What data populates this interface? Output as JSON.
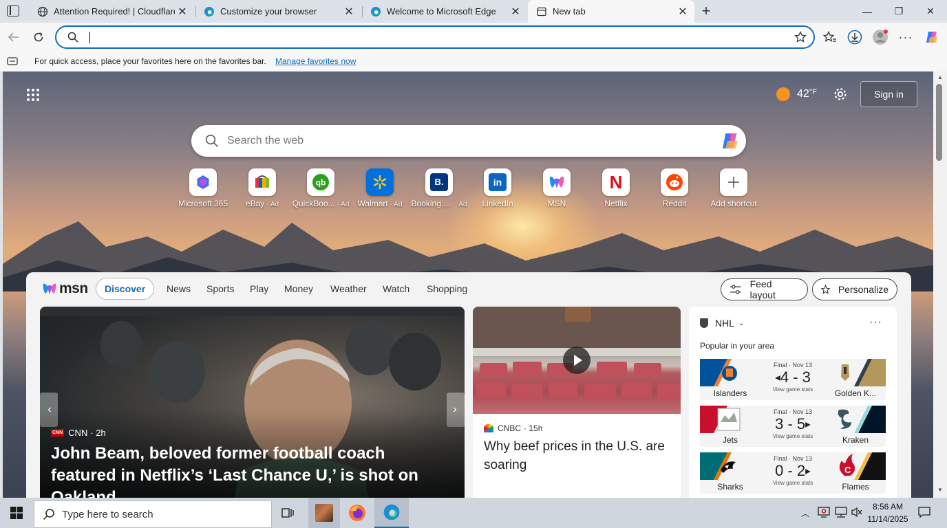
{
  "browser": {
    "tabs": [
      {
        "title": "Attention Required! | Cloudflare",
        "icon": "globe-icon",
        "active": false
      },
      {
        "title": "Customize your browser",
        "icon": "edge-icon",
        "active": false
      },
      {
        "title": "Welcome to Microsoft Edge",
        "icon": "edge-icon",
        "active": false
      },
      {
        "title": "New tab",
        "icon": "newtab-icon",
        "active": true
      }
    ],
    "new_tab_symbol": "+",
    "window_controls": {
      "minimize": "—",
      "maximize": "❐",
      "close": "✕"
    },
    "address_value": "",
    "favorites_bar": {
      "message": "For quick access, place your favorites here on the favorites bar.",
      "link": "Manage favorites now"
    }
  },
  "newtab": {
    "weather": {
      "temp": "42",
      "unit": "°F"
    },
    "sign_in": "Sign in",
    "search_placeholder": "Search the web",
    "shortcuts": [
      {
        "label": "Microsoft 365",
        "ad": "",
        "icon": "microsoft365-icon"
      },
      {
        "label": "eBay",
        "ad": "· Ad",
        "icon": "ebay-icon"
      },
      {
        "label": "QuickBoo...",
        "ad": "· Ad",
        "icon": "quickbooks-icon"
      },
      {
        "label": "Walmart",
        "ad": "· Ad",
        "icon": "walmart-icon"
      },
      {
        "label": "Booking....",
        "ad": "Ad",
        "icon": "booking-icon"
      },
      {
        "label": "LinkedIn",
        "ad": "",
        "icon": "linkedin-icon"
      },
      {
        "label": "MSN",
        "ad": "",
        "icon": "msn-icon"
      },
      {
        "label": "Netflix",
        "ad": "",
        "icon": "netflix-icon"
      },
      {
        "label": "Reddit",
        "ad": "",
        "icon": "reddit-icon"
      },
      {
        "label": "Add shortcut",
        "ad": "",
        "icon": "add-icon"
      }
    ]
  },
  "feed": {
    "brand": "msn",
    "nav": [
      "Discover",
      "News",
      "Sports",
      "Play",
      "Money",
      "Weather",
      "Watch",
      "Shopping"
    ],
    "active_nav": "Discover",
    "feed_layout": "Feed layout",
    "personalize": "Personalize",
    "hero": {
      "source": "CNN",
      "source_logo": "CNN",
      "age": "· 2h",
      "headline": "John Beam, beloved former football coach featured in Netflix’s ‘Last Chance U,’ is shot on Oakland..."
    },
    "card2": {
      "source": "CNBC",
      "age": "· 15h",
      "headline": "Why beef prices in the U.S. are soaring"
    },
    "nhl": {
      "league": "NHL",
      "subtitle": "Popular in your area",
      "games": [
        {
          "status": "Final · Nov 13",
          "score": "4 - 3",
          "winner": "left",
          "left": "Islanders",
          "right": "Golden K...",
          "link": "View game stats",
          "left_color": "#00539b",
          "right_color": "#b4975a"
        },
        {
          "status": "Final · Nov 13",
          "score": "3 - 5",
          "winner": "right",
          "left": "Jets",
          "right": "Kraken",
          "link": "View game stats",
          "left_color": "#c8102e",
          "right_color": "#001628"
        },
        {
          "status": "Final · Nov 13",
          "score": "0 - 2",
          "winner": "right",
          "left": "Sharks",
          "right": "Flames",
          "link": "View game stats",
          "left_color": "#006d75",
          "right_color": "#111111"
        }
      ]
    }
  },
  "taskbar": {
    "search_placeholder": "Type here to search",
    "time": "8:56 AM",
    "date": "11/14/2025"
  },
  "colors": {
    "accent": "#0f6cbd",
    "link": "#0f6cbd"
  }
}
